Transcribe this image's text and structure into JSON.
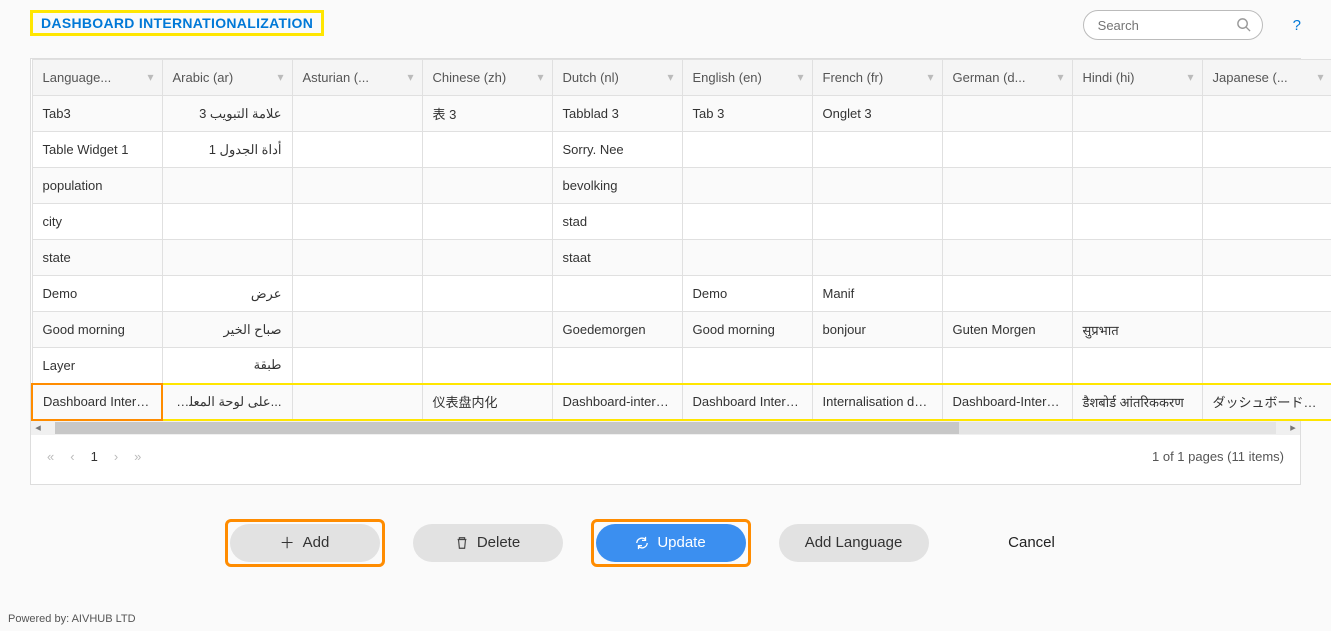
{
  "title": "DASHBOARD INTERNATIONALIZATION",
  "search": {
    "placeholder": "Search"
  },
  "columns": [
    "Language...",
    "Arabic (ar)",
    "Asturian (...",
    "Chinese (zh)",
    "Dutch (nl)",
    "English (en)",
    "French (fr)",
    "German (d...",
    "Hindi (hi)",
    "Japanese (..."
  ],
  "rows": [
    {
      "key": "Tab3",
      "ar": "علامة التبويب 3",
      "ast": "",
      "zh": "表 3",
      "nl": "Tabblad 3",
      "en": "Tab 3",
      "fr": "Onglet 3",
      "de": "",
      "hi": "",
      "ja": ""
    },
    {
      "key": "Table Widget 1",
      "ar": "أداة الجدول 1",
      "ast": "",
      "zh": "",
      "nl": "Sorry. Nee",
      "en": "",
      "fr": "",
      "de": "",
      "hi": "",
      "ja": ""
    },
    {
      "key": "population",
      "ar": "",
      "ast": "",
      "zh": "",
      "nl": "bevolking",
      "en": "",
      "fr": "",
      "de": "",
      "hi": "",
      "ja": ""
    },
    {
      "key": "city",
      "ar": "",
      "ast": "",
      "zh": "",
      "nl": "stad",
      "en": "",
      "fr": "",
      "de": "",
      "hi": "",
      "ja": ""
    },
    {
      "key": "state",
      "ar": "",
      "ast": "",
      "zh": "",
      "nl": "staat",
      "en": "",
      "fr": "",
      "de": "",
      "hi": "",
      "ja": ""
    },
    {
      "key": "Demo",
      "ar": "عرض",
      "ast": "",
      "zh": "",
      "nl": "",
      "en": "Demo",
      "fr": "Manif",
      "de": "",
      "hi": "",
      "ja": ""
    },
    {
      "key": "Good morning",
      "ar": "صباح الخير",
      "ast": "",
      "zh": "",
      "nl": "Goedemorgen",
      "en": "Good morning",
      "fr": "bonjour",
      "de": "Guten Morgen",
      "hi": "सुप्रभात",
      "ja": ""
    },
    {
      "key": "Layer",
      "ar": "طبقة",
      "ast": "",
      "zh": "",
      "nl": "",
      "en": "",
      "fr": "",
      "de": "",
      "hi": "",
      "ja": ""
    },
    {
      "key": "Dashboard Interna...",
      "ar": "...على لوحة المعلومات",
      "ast": "",
      "zh": "仪表盘内化",
      "nl": "Dashboard-interna...",
      "en": "Dashboard Interna...",
      "fr": "Internalisation du ...",
      "de": "Dashboard-Intern...",
      "hi": "डैशबोर्ड आंतरिककरण",
      "ja": "ダッシュボードの..."
    }
  ],
  "pager": {
    "page": "1",
    "info": "1 of 1 pages (11 items)"
  },
  "buttons": {
    "add": "Add",
    "delete": "Delete",
    "update": "Update",
    "addlang": "Add Language",
    "cancel": "Cancel"
  },
  "footer": "Powered by: AIVHUB LTD"
}
